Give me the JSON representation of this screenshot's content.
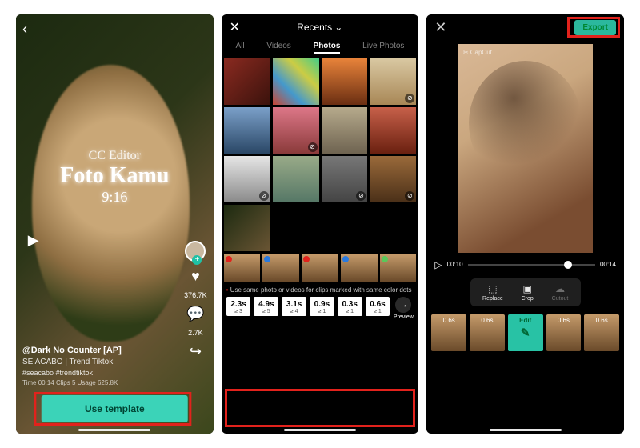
{
  "panel1": {
    "overlay": {
      "line1": "CC Editor",
      "line2": "Foto Kamu",
      "line3": "9:16"
    },
    "likes": "376.7K",
    "comments": "2.7K",
    "title": "@Dark No Counter [AP]",
    "subtitle": "SE ACABO | Trend Tiktok",
    "hashtags": "#seacabo #trendtiktok",
    "stats": "Time 00:14 Clips 5 Usage 625.8K",
    "cta": "Use template"
  },
  "panel2": {
    "title": "Recents",
    "tabs": [
      "All",
      "Videos",
      "Photos",
      "Live Photos"
    ],
    "activeTab": 2,
    "hint": "Use same photo or videos for clips marked with same color dots",
    "thumbs": [
      {
        "cls": "t-a",
        "badge": ""
      },
      {
        "cls": "t-b",
        "badge": ""
      },
      {
        "cls": "t-c",
        "badge": ""
      },
      {
        "cls": "t-d",
        "badge": "⊘"
      },
      {
        "cls": "t-e",
        "badge": ""
      },
      {
        "cls": "t-f",
        "badge": "⊘"
      },
      {
        "cls": "t-g",
        "badge": ""
      },
      {
        "cls": "t-h",
        "badge": ""
      },
      {
        "cls": "t-i",
        "badge": "⊘"
      },
      {
        "cls": "t-j",
        "badge": ""
      },
      {
        "cls": "t-k",
        "badge": "⊘"
      },
      {
        "cls": "t-l",
        "badge": "⊘"
      },
      {
        "cls": "t-m",
        "badge": ""
      }
    ],
    "stripDots": [
      "#e2221c",
      "#2a7adf",
      "#e2221c",
      "#2a7adf",
      "#5ac85a"
    ],
    "durations": [
      {
        "t": "2.3s",
        "s": "≥ 3"
      },
      {
        "t": "4.9s",
        "s": "≥ 5"
      },
      {
        "t": "3.1s",
        "s": "≥ 4"
      },
      {
        "t": "0.9s",
        "s": "≥ 1"
      },
      {
        "t": "0.3s",
        "s": "≥ 1"
      },
      {
        "t": "0.6s",
        "s": "≥ 1"
      }
    ],
    "previewLabel": "Preview"
  },
  "panel3": {
    "export": "Export",
    "watermark": "✂ CapCut",
    "timeline": {
      "cur": "00:10",
      "end": "00:14"
    },
    "tools": [
      {
        "icon": "⬚",
        "label": "Replace",
        "disabled": false
      },
      {
        "icon": "▣",
        "label": "Crop",
        "disabled": false
      },
      {
        "icon": "☁",
        "label": "Cutout",
        "disabled": true
      }
    ],
    "clips": [
      {
        "label": "0.6s",
        "sel": false
      },
      {
        "label": "0.6s",
        "sel": false
      },
      {
        "label": "Edit",
        "sel": true
      },
      {
        "label": "0.6s",
        "sel": false
      },
      {
        "label": "0.6s",
        "sel": false
      }
    ]
  }
}
